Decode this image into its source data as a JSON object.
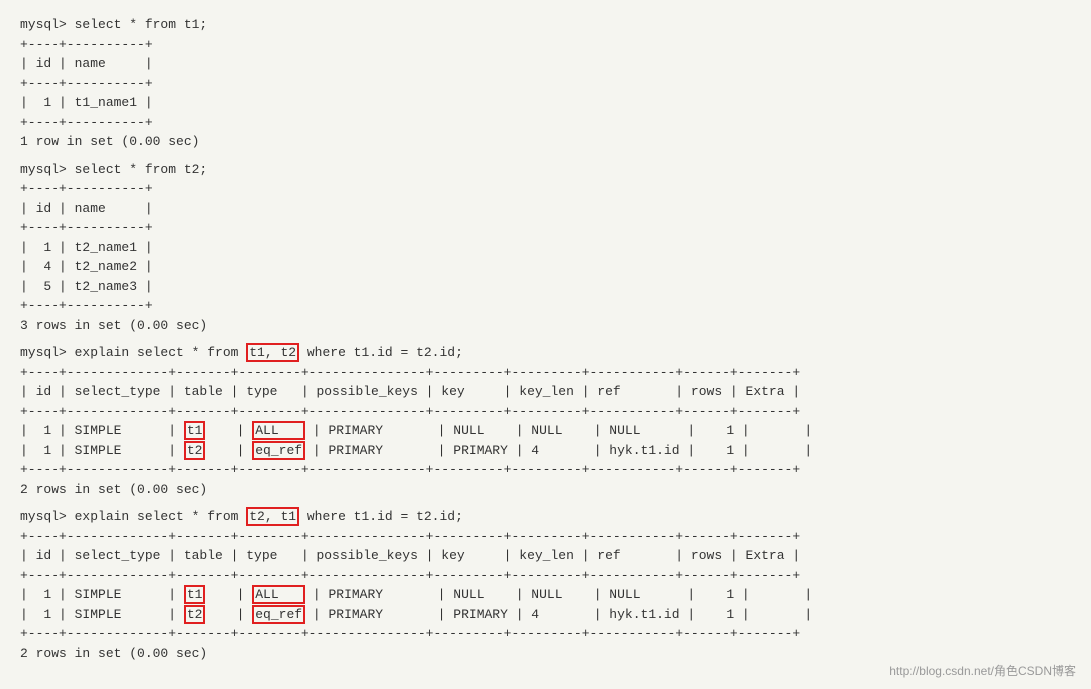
{
  "terminal": {
    "watermark": "http://blog.csdn.net/角色CSDN博客",
    "blocks": [
      {
        "id": "block1",
        "command": "mysql> select * from t1;",
        "lines": [
          "+----+----------+",
          "| id | name     |",
          "+----+----------+",
          "|  1 | t1_name1 |",
          "+----+----------+",
          "1 row in set (0.00 sec)"
        ]
      },
      {
        "id": "block2",
        "command": "mysql> select * from t2;",
        "lines": [
          "+----+----------+",
          "| id | name     |",
          "+----+----------+",
          "|  1 | t2_name1 |",
          "|  4 | t2_name2 |",
          "|  5 | t2_name3 |",
          "+----+----------+",
          "3 rows in set (0.00 sec)"
        ]
      },
      {
        "id": "block3",
        "command_prefix": "mysql> explain select * from ",
        "command_highlight1": "t1, t2",
        "command_suffix": " where t1.id = t2.id;",
        "separator": "+----+-------------+-------+--------+---------------+---------+---------+-----------+------+-------+",
        "header": "| id | select_type | table | type   | possible_keys | key     | key_len | ref       | rows | Extra |",
        "rows": [
          {
            "id": "1",
            "select_type": "SIMPLE",
            "table_highlight": "t1",
            "type_highlight": "ALL",
            "possible_keys": "PRIMARY",
            "key": "NULL",
            "key_len": "NULL",
            "ref": "NULL",
            "rows": "1",
            "extra": ""
          },
          {
            "id": "1",
            "select_type": "SIMPLE",
            "table_highlight": "t2",
            "type_highlight": "eq_ref",
            "possible_keys": "PRIMARY",
            "key": "PRIMARY",
            "key_len": "4",
            "ref": "hyk.t1.id",
            "rows": "1",
            "extra": ""
          }
        ],
        "footer": "2 rows in set (0.00 sec)"
      },
      {
        "id": "block4",
        "command_prefix": "mysql> explain select * from ",
        "command_highlight1": "t2, t1",
        "command_suffix": " where t1.id = t2.id;",
        "separator": "+----+-------------+-------+--------+---------------+---------+---------+-----------+------+-------+",
        "header": "| id | select_type | table | type   | possible_keys | key     | key_len | ref       | rows | Extra |",
        "rows": [
          {
            "id": "1",
            "select_type": "SIMPLE",
            "table_highlight": "t1",
            "type_highlight": "ALL",
            "possible_keys": "PRIMARY",
            "key": "NULL",
            "key_len": "NULL",
            "ref": "NULL",
            "rows": "1",
            "extra": ""
          },
          {
            "id": "1",
            "select_type": "SIMPLE",
            "table_highlight": "t2",
            "type_highlight": "eq_ref",
            "possible_keys": "PRIMARY",
            "key": "PRIMARY",
            "key_len": "4",
            "ref": "hyk.t1.id",
            "rows": "1",
            "extra": ""
          }
        ],
        "footer": "2 rows in set (0.00 sec)"
      }
    ]
  }
}
